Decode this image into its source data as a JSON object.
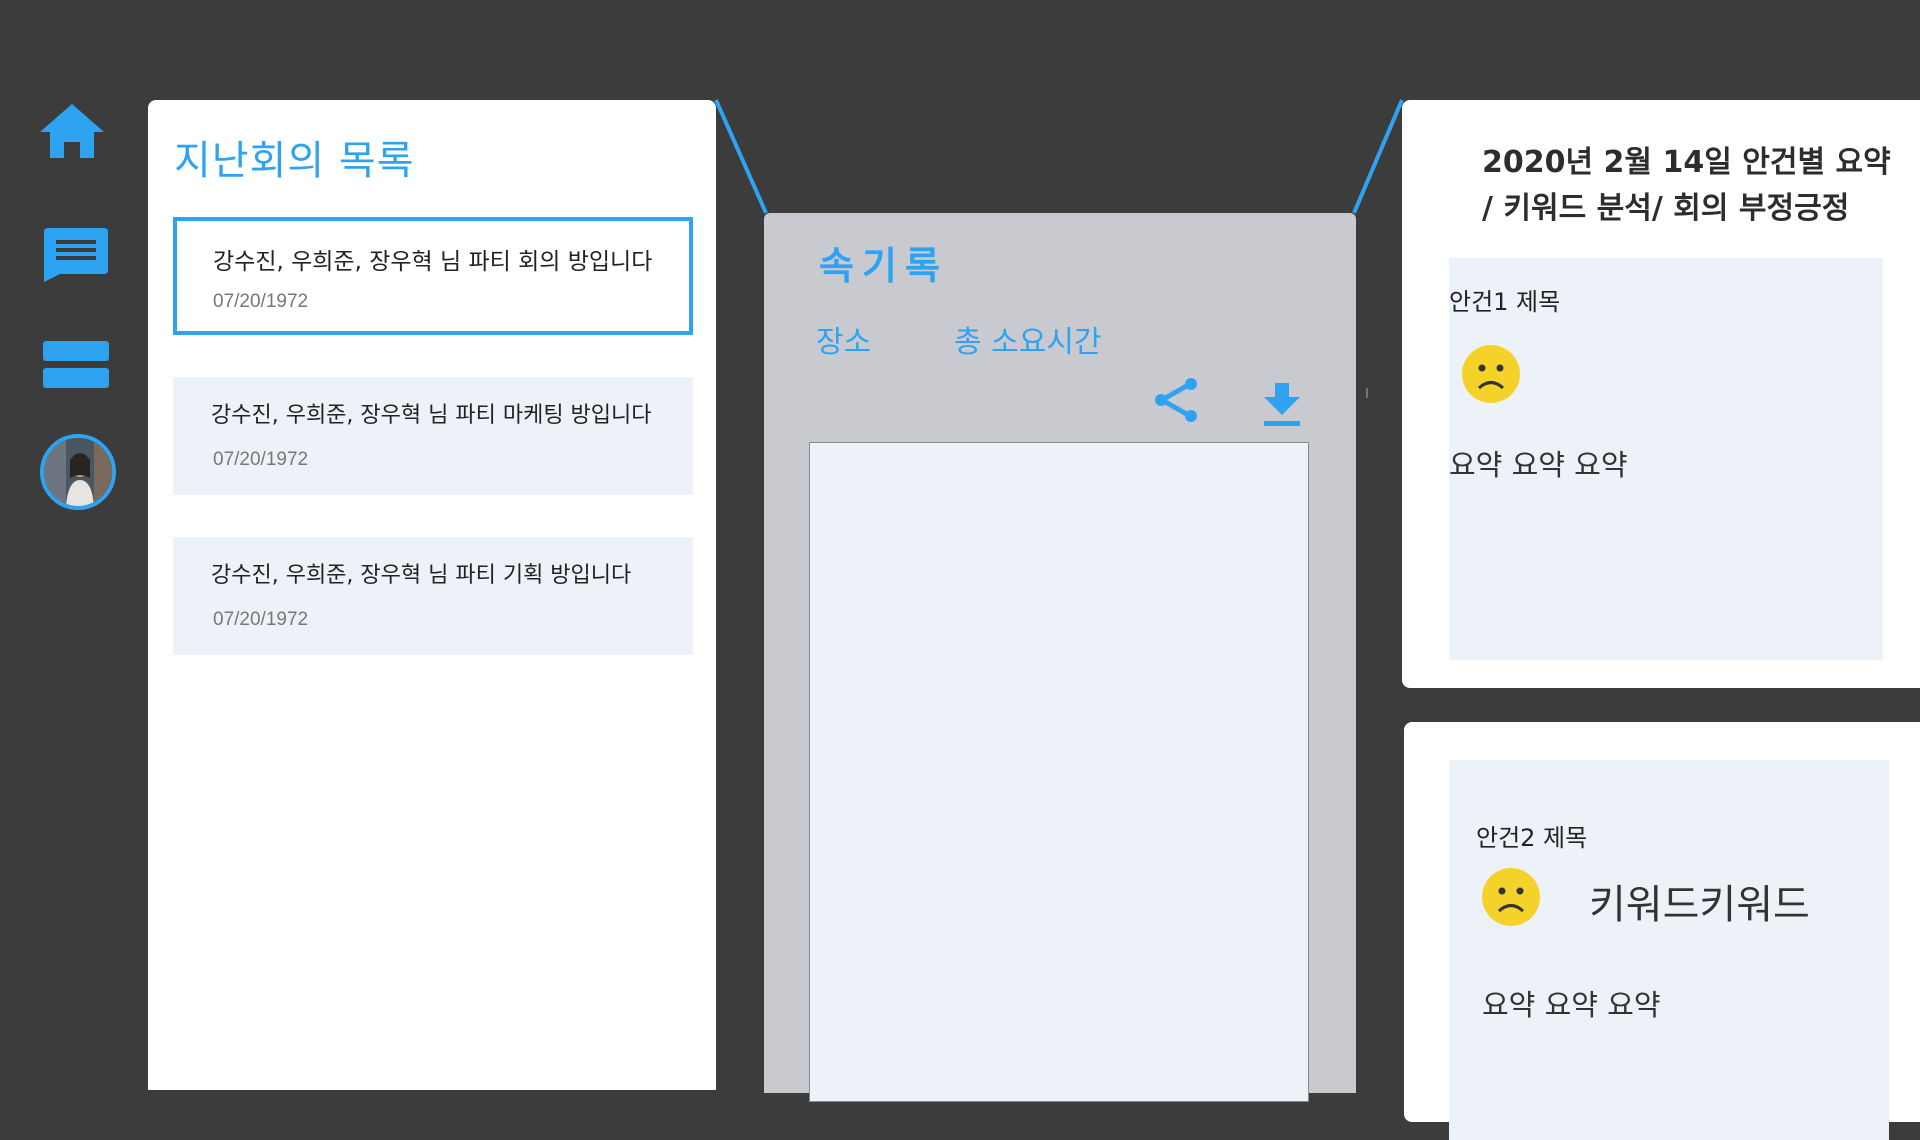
{
  "nav": {
    "items": [
      {
        "name": "home",
        "icon": "home-icon"
      },
      {
        "name": "chat",
        "icon": "chat-icon"
      },
      {
        "name": "list",
        "icon": "list-icon"
      },
      {
        "name": "profile",
        "icon": "avatar"
      }
    ],
    "accent_color": "#2ea3f2"
  },
  "meeting_list": {
    "title": "지난회의 목록",
    "items": [
      {
        "title": "강수진, 우희준, 장우혁 님 파티 회의 방입니다",
        "date": "07/20/1972",
        "selected": true
      },
      {
        "title": "강수진, 우희준, 장우혁 님 파티 마케팅 방입니다",
        "date": "07/20/1972",
        "selected": false
      },
      {
        "title": "강수진, 우희준, 장우혁 님 파티 기획 방입니다",
        "date": "07/20/1972",
        "selected": false
      }
    ]
  },
  "record": {
    "title": "속기록",
    "place_label": "장소",
    "total_time_label": "총 소요시간",
    "actions": [
      {
        "name": "share",
        "icon": "share-icon"
      },
      {
        "name": "download",
        "icon": "download-icon"
      }
    ]
  },
  "summary": {
    "heading_line1": "2020년 2월 14일 안건별 요약",
    "heading_line2": "/ 키워드 분석/ 회의 부정긍정",
    "agendas": [
      {
        "title": "안건1 제목",
        "sentiment": "sad-face-icon",
        "summary": "요약 요약 요약"
      },
      {
        "title": "안건2 제목",
        "sentiment": "sad-face-icon",
        "keyword": "키워드키워드",
        "summary": "요약 요약 요약"
      }
    ]
  },
  "colors": {
    "background": "#3c3c3c",
    "accent": "#2ea3f2",
    "card": "#edf2f9",
    "record_panel": "#c9cacf"
  }
}
